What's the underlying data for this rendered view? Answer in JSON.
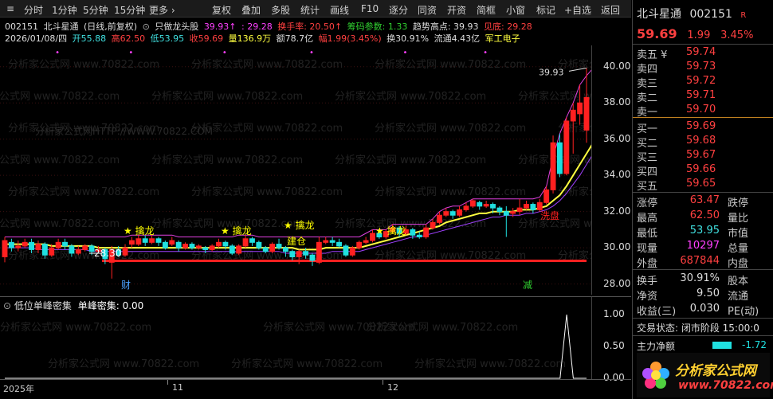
{
  "toolbar": {
    "tabs": [
      "分时",
      "1分钟",
      "5分钟",
      "15分钟",
      "更多 ›"
    ],
    "buttons": [
      "复权",
      "叠加",
      "多股",
      "统计",
      "画线",
      "F10",
      "逐分",
      "同资",
      "开资",
      "简框",
      "小窗",
      "标记",
      "+自选",
      "返回"
    ]
  },
  "header": {
    "code": "002151",
    "name": "北斗星通",
    "mode": "(日线,前复权)",
    "indicator": "只做龙头股",
    "ind_v1": "39.93↑",
    "ind_v2": ": 29.28",
    "turnover_label": "换手率: 20.50↑",
    "chip_label": "筹码参数: 1.33",
    "trend_label": "趋势高点: 39.93",
    "bottom_label": "见底: 29.28",
    "date": "2026/01/08/四",
    "open": "开55.88",
    "high": "高62.50",
    "low": "低53.95",
    "close": "收59.69",
    "volume": "量136.9万",
    "amount": "额78.7亿",
    "amplitude": "幅1.99(3.45%)",
    "turnover": "换30.91%",
    "float_value": "流通4.43亿",
    "sector": "军工电子"
  },
  "watermark": "分析家公式网 www.70822.com",
  "watermark_url": "分析家公式网HTTP://WWW.70822.COM",
  "chart_data": {
    "type": "candlestick",
    "ylim": [
      27.5,
      41
    ],
    "yticks": [
      "40.00",
      "38.00",
      "36.00",
      "34.00",
      "32.00",
      "30.00",
      "28.00"
    ],
    "ytick_values": [
      40,
      38,
      36,
      34,
      32,
      30,
      28
    ],
    "max_label": "39.93",
    "annotations": [
      {
        "text": "★ 擒龙",
        "color": "#ffff00"
      },
      {
        "text": "★ 擒龙",
        "color": "#ffff00"
      },
      {
        "text": "★ 擒龙",
        "color": "#ffff00"
      },
      {
        "text": "★ 擒龙",
        "color": "#ffff00"
      },
      {
        "text": "建仓",
        "color": "#ffff00"
      },
      {
        "text": "洗盘",
        "color": "#ff2020"
      },
      {
        "text": "28.30",
        "color": "#ffffff"
      }
    ],
    "support_level": 29.28,
    "events": [
      {
        "text": "财",
        "color": "#4aa0ff"
      },
      {
        "text": "减",
        "color": "#30d030"
      }
    ],
    "candles": [
      [
        29.5,
        30.4,
        30.6,
        29.2
      ],
      [
        30.3,
        30.0,
        30.5,
        29.8
      ],
      [
        30.0,
        30.1,
        30.4,
        29.8
      ],
      [
        30.1,
        30.3,
        30.5,
        30.0
      ],
      [
        30.3,
        29.9,
        30.5,
        29.7
      ],
      [
        29.9,
        30.2,
        30.4,
        29.7
      ],
      [
        30.2,
        29.6,
        30.3,
        29.4
      ],
      [
        29.6,
        30.0,
        30.2,
        29.5
      ],
      [
        30.0,
        30.3,
        30.5,
        29.9
      ],
      [
        30.3,
        30.1,
        30.5,
        29.9
      ],
      [
        30.1,
        29.7,
        30.2,
        29.5
      ],
      [
        29.7,
        29.9,
        30.1,
        29.6
      ],
      [
        29.9,
        30.1,
        30.2,
        29.8
      ],
      [
        30.1,
        29.8,
        30.2,
        29.6
      ],
      [
        29.8,
        29.9,
        30.1,
        29.7
      ],
      [
        29.9,
        29.4,
        30.0,
        29.1
      ],
      [
        29.2,
        29.9,
        30.1,
        28.3
      ],
      [
        29.9,
        29.6,
        30.1,
        29.5
      ],
      [
        29.6,
        30.0,
        30.2,
        29.5
      ],
      [
        30.2,
        30.4,
        30.6,
        30.0
      ],
      [
        30.2,
        30.5,
        30.7,
        30.1
      ],
      [
        30.5,
        30.3,
        30.7,
        30.1
      ],
      [
        30.3,
        30.5,
        30.7,
        30.2
      ],
      [
        30.5,
        30.3,
        30.6,
        30.1
      ],
      [
        30.3,
        30.0,
        30.4,
        29.9
      ],
      [
        30.2,
        30.4,
        30.6,
        30.1
      ],
      [
        30.3,
        30.0,
        30.4,
        29.8
      ],
      [
        30.0,
        30.2,
        30.3,
        29.9
      ],
      [
        30.2,
        30.0,
        30.3,
        29.9
      ],
      [
        30.0,
        30.1,
        30.2,
        29.9
      ],
      [
        30.0,
        29.9,
        30.1,
        29.7
      ],
      [
        29.9,
        30.1,
        30.2,
        29.8
      ],
      [
        30.1,
        30.3,
        30.5,
        30.0
      ],
      [
        30.3,
        30.1,
        30.4,
        29.9
      ],
      [
        30.1,
        29.7,
        30.2,
        29.6
      ],
      [
        29.7,
        30.1,
        30.2,
        29.6
      ],
      [
        30.1,
        30.5,
        30.7,
        30.0
      ],
      [
        30.5,
        30.3,
        30.6,
        30.1
      ],
      [
        30.3,
        30.0,
        30.4,
        29.9
      ],
      [
        30.0,
        29.8,
        30.1,
        29.7
      ],
      [
        29.8,
        30.2,
        30.3,
        29.7
      ],
      [
        30.2,
        30.0,
        30.5,
        29.9
      ],
      [
        30.0,
        29.8,
        30.1,
        29.5
      ],
      [
        29.8,
        29.5,
        29.9,
        29.3
      ],
      [
        29.5,
        29.8,
        29.9,
        29.1
      ],
      [
        29.8,
        29.6,
        30.0,
        29.4
      ],
      [
        29.6,
        29.3,
        29.7,
        29.0
      ],
      [
        29.2,
        30.3,
        30.6,
        29.1
      ],
      [
        30.3,
        30.4,
        30.6,
        30.2
      ],
      [
        30.4,
        30.3,
        30.6,
        30.1
      ],
      [
        30.3,
        30.1,
        30.5,
        30.0
      ],
      [
        30.1,
        29.6,
        30.2,
        29.5
      ],
      [
        29.6,
        30.0,
        30.1,
        29.5
      ],
      [
        30.0,
        30.3,
        30.4,
        29.9
      ],
      [
        30.3,
        30.4,
        30.6,
        30.2
      ],
      [
        30.4,
        30.8,
        31.0,
        30.3
      ],
      [
        30.8,
        30.6,
        30.9,
        30.5
      ],
      [
        30.6,
        30.9,
        31.0,
        30.5
      ],
      [
        30.9,
        31.1,
        31.3,
        30.8
      ],
      [
        31.1,
        30.8,
        31.2,
        30.6
      ],
      [
        30.8,
        31.0,
        31.2,
        30.7
      ],
      [
        31.0,
        30.7,
        31.1,
        30.5
      ],
      [
        30.7,
        30.6,
        30.9,
        30.5
      ],
      [
        30.6,
        31.1,
        31.3,
        30.5
      ],
      [
        31.1,
        31.4,
        31.6,
        31.0
      ],
      [
        31.4,
        31.8,
        32.0,
        31.3
      ],
      [
        31.8,
        32.0,
        32.2,
        31.7
      ],
      [
        32.0,
        31.8,
        32.1,
        31.6
      ],
      [
        31.8,
        32.1,
        32.3,
        31.7
      ],
      [
        32.1,
        32.3,
        32.5,
        32.0
      ],
      [
        32.3,
        32.6,
        32.7,
        32.2
      ],
      [
        32.5,
        32.3,
        32.6,
        32.1
      ],
      [
        32.3,
        32.4,
        32.6,
        32.2
      ],
      [
        32.4,
        32.2,
        32.5,
        31.9
      ],
      [
        32.2,
        32.0,
        32.3,
        31.8
      ],
      [
        32.0,
        31.8,
        32.3,
        30.6
      ],
      [
        31.9,
        32.0,
        32.2,
        31.7
      ],
      [
        32.0,
        32.2,
        32.7,
        31.8
      ],
      [
        32.2,
        32.4,
        32.6,
        32.1
      ],
      [
        32.4,
        32.1,
        32.5,
        31.9
      ],
      [
        32.1,
        32.5,
        32.7,
        32.0
      ],
      [
        32.5,
        33.2,
        33.4,
        32.4
      ],
      [
        33.2,
        35.8,
        36.2,
        33.0
      ],
      [
        35.8,
        34.1,
        36.3,
        33.9
      ],
      [
        34.1,
        37.0,
        37.2,
        34.0
      ],
      [
        37.0,
        37.6,
        38.0,
        35.2
      ],
      [
        37.4,
        38.0,
        39.0,
        36.8
      ],
      [
        36.5,
        38.3,
        39.93,
        35.8
      ]
    ],
    "ma_yellow": [
      30.2,
      30.2,
      30.2,
      30.2,
      30.2,
      30.2,
      30.2,
      30.1,
      30.1,
      30.1,
      30.1,
      30.1,
      30.1,
      30.1,
      30.0,
      30.0,
      30.0,
      30.0,
      30.0,
      30.0,
      30.0,
      30.0,
      30.0,
      30.0,
      30.0,
      30.0,
      30.0,
      30.0,
      30.0,
      30.0,
      30.0,
      30.0,
      30.0,
      30.0,
      30.0,
      30.0,
      30.0,
      30.0,
      30.0,
      30.0,
      30.0,
      30.0,
      30.0,
      30.0,
      29.9,
      29.9,
      29.9,
      29.9,
      30.0,
      30.0,
      30.0,
      30.0,
      30.0,
      30.0,
      30.1,
      30.2,
      30.3,
      30.4,
      30.5,
      30.6,
      30.7,
      30.8,
      30.9,
      31.0,
      31.1,
      31.2,
      31.4,
      31.5,
      31.6,
      31.7,
      31.8,
      31.9,
      31.9,
      32.0,
      32.0,
      32.0,
      32.0,
      32.1,
      32.1,
      32.1,
      32.2,
      32.3,
      32.6,
      32.9,
      33.4,
      34.0,
      34.6,
      35.2,
      35.8
    ],
    "ma_magenta": [
      30.6,
      30.6,
      30.6,
      30.6,
      30.6,
      30.6,
      30.6,
      30.6,
      30.6,
      30.6,
      30.6,
      30.6,
      30.6,
      30.6,
      30.6,
      30.6,
      30.6,
      30.6,
      30.6,
      30.7,
      30.7,
      30.7,
      30.7,
      30.7,
      30.7,
      30.7,
      30.6,
      30.6,
      30.6,
      30.6,
      30.6,
      30.6,
      30.6,
      30.6,
      30.6,
      30.7,
      30.7,
      30.7,
      30.6,
      30.6,
      30.6,
      30.6,
      30.6,
      30.6,
      30.6,
      30.6,
      30.6,
      30.6,
      30.6,
      30.6,
      30.6,
      30.6,
      30.6,
      30.6,
      30.8,
      31.0,
      31.0,
      31.0,
      31.3,
      31.3,
      31.3,
      31.3,
      31.3,
      31.3,
      31.6,
      32.0,
      32.2,
      32.3,
      32.3,
      32.5,
      32.7,
      32.7,
      32.7,
      32.7,
      32.7,
      32.7,
      32.7,
      32.7,
      32.7,
      32.7,
      32.8,
      33.4,
      35.0,
      36.3,
      37.2,
      38.0,
      39.0,
      39.5,
      39.93
    ],
    "ma_purple": [
      30.0,
      30.0,
      30.0,
      30.0,
      30.0,
      29.9,
      29.9,
      29.9,
      29.9,
      29.9,
      29.9,
      29.9,
      29.9,
      29.8,
      29.8,
      29.8,
      29.8,
      29.8,
      29.8,
      29.8,
      29.8,
      29.8,
      29.8,
      29.8,
      29.8,
      29.8,
      29.8,
      29.8,
      29.8,
      29.8,
      29.8,
      29.8,
      29.8,
      29.8,
      29.8,
      29.8,
      29.8,
      29.8,
      29.8,
      29.8,
      29.8,
      29.8,
      29.7,
      29.7,
      29.7,
      29.7,
      29.7,
      29.7,
      29.7,
      29.8,
      29.8,
      29.8,
      29.8,
      29.8,
      29.9,
      30.0,
      30.1,
      30.2,
      30.3,
      30.4,
      30.5,
      30.6,
      30.6,
      30.7,
      30.8,
      30.9,
      31.0,
      31.1,
      31.2,
      31.3,
      31.4,
      31.5,
      31.6,
      31.7,
      31.7,
      31.8,
      31.8,
      31.8,
      31.9,
      31.9,
      32.0,
      32.1,
      32.3,
      32.6,
      33.0,
      33.5,
      34.0,
      34.6,
      35.2
    ]
  },
  "subchart": {
    "title": "低位单峰密集",
    "label": "单峰密集: 0.00",
    "yticks": [
      "1.00",
      "0.50",
      "0.00"
    ],
    "ytick_values": [
      1,
      0.5,
      0
    ],
    "values": [
      0,
      0,
      0,
      0,
      0,
      0,
      0,
      0,
      0,
      0,
      0,
      0,
      0,
      0,
      0,
      0,
      0,
      0,
      0,
      0,
      0,
      0,
      0,
      0,
      0,
      0,
      0,
      0,
      0,
      0,
      0,
      0,
      0,
      0,
      0,
      0,
      0,
      0,
      0,
      0,
      0,
      0,
      0,
      0,
      0,
      0,
      0,
      0,
      0,
      0,
      0,
      0,
      0,
      0,
      0,
      0,
      0,
      0,
      0,
      0,
      0,
      0,
      0,
      0,
      0,
      0,
      0,
      0,
      0,
      0,
      0,
      0,
      0,
      0,
      0,
      0,
      0,
      0,
      0,
      0,
      0,
      0,
      0,
      0,
      0,
      1,
      0,
      0,
      0
    ]
  },
  "xaxis": {
    "labels": [
      "2025年",
      "11",
      "12"
    ]
  },
  "right": {
    "name": "北斗星通",
    "code": "002151",
    "badge": "R",
    "price": "59.69",
    "change": "1.99",
    "pct": "3.45%",
    "asks": [
      {
        "label": "卖五 ¥",
        "price": "59.74"
      },
      {
        "label": "卖四",
        "price": "59.73"
      },
      {
        "label": "卖三",
        "price": "59.72"
      },
      {
        "label": "卖二",
        "price": "59.71"
      },
      {
        "label": "卖一",
        "price": "59.70"
      }
    ],
    "bids": [
      {
        "label": "买一",
        "price": "59.69"
      },
      {
        "label": "买二",
        "price": "59.68"
      },
      {
        "label": "买三",
        "price": "59.67"
      },
      {
        "label": "买四",
        "price": "59.66"
      },
      {
        "label": "买五",
        "price": "59.65"
      }
    ],
    "stats": [
      {
        "a": "涨停",
        "b": "63.47",
        "c": "跌停",
        "color": "#ff4040"
      },
      {
        "a": "最高",
        "b": "62.50",
        "c": "量比",
        "color": "#ff4040"
      },
      {
        "a": "最低",
        "b": "53.95",
        "c": "市值",
        "color": "#40e0e0"
      },
      {
        "a": "现量",
        "b": "10297",
        "c": "总量",
        "color": "#ff40ff"
      },
      {
        "a": "外盘",
        "b": "687844",
        "c": "内盘",
        "color": "#ff4040"
      }
    ],
    "stats2": [
      {
        "a": "换手",
        "b": "30.91%",
        "c": "股本",
        "color": "#dddddd"
      },
      {
        "a": "净资",
        "b": "9.50",
        "c": "流通",
        "color": "#dddddd"
      },
      {
        "a": "收益(三)",
        "b": "0.030",
        "c": "PE(动)",
        "color": "#dddddd"
      }
    ],
    "trade_status": "交易状态: 闭市阶段 15:00:0",
    "main_flow_label": "主力净额",
    "main_flow_value": "-1.72",
    "logo_text": "分析家公式网",
    "logo_url": "www.70822.com"
  }
}
